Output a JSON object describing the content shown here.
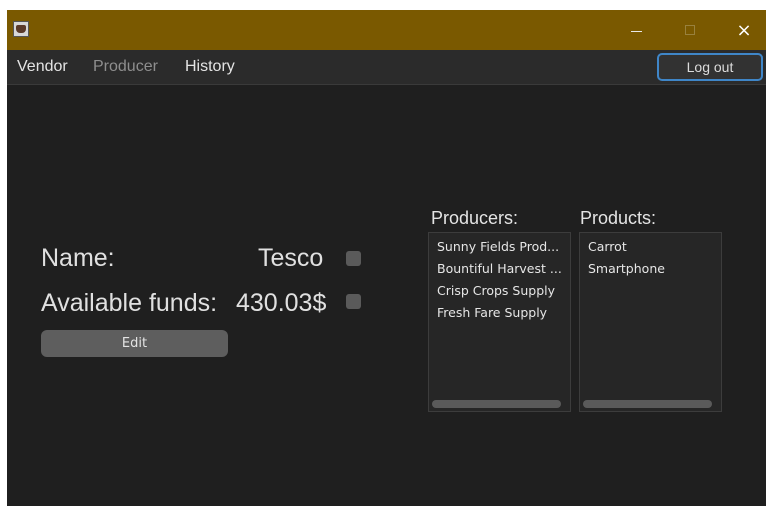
{
  "window": {
    "title": "",
    "controls": {
      "minimize": "minimize-icon",
      "maximize": "maximize-icon",
      "close": "×"
    }
  },
  "menu": {
    "vendor": "Vendor",
    "producer": "Producer",
    "history": "History",
    "logout": "Log out"
  },
  "profile": {
    "name_label": "Name:",
    "name_value": "Tesco",
    "funds_label": "Available funds:",
    "funds_value": "430.03$",
    "edit_label": "Edit"
  },
  "producers": {
    "header": "Producers:",
    "items": [
      "Sunny Fields Prod...",
      "Bountiful Harvest ...",
      "Crisp Crops Supply",
      "Fresh Fare Supply"
    ]
  },
  "products": {
    "header": "Products:",
    "items": [
      "Carrot",
      "Smartphone"
    ]
  },
  "colors": {
    "titlebar": "#7a5900",
    "background": "#1f1f1f",
    "menubar": "#2b2b2b",
    "focus_border": "#3f86c8",
    "disabled_text": "#8e8e8e"
  }
}
